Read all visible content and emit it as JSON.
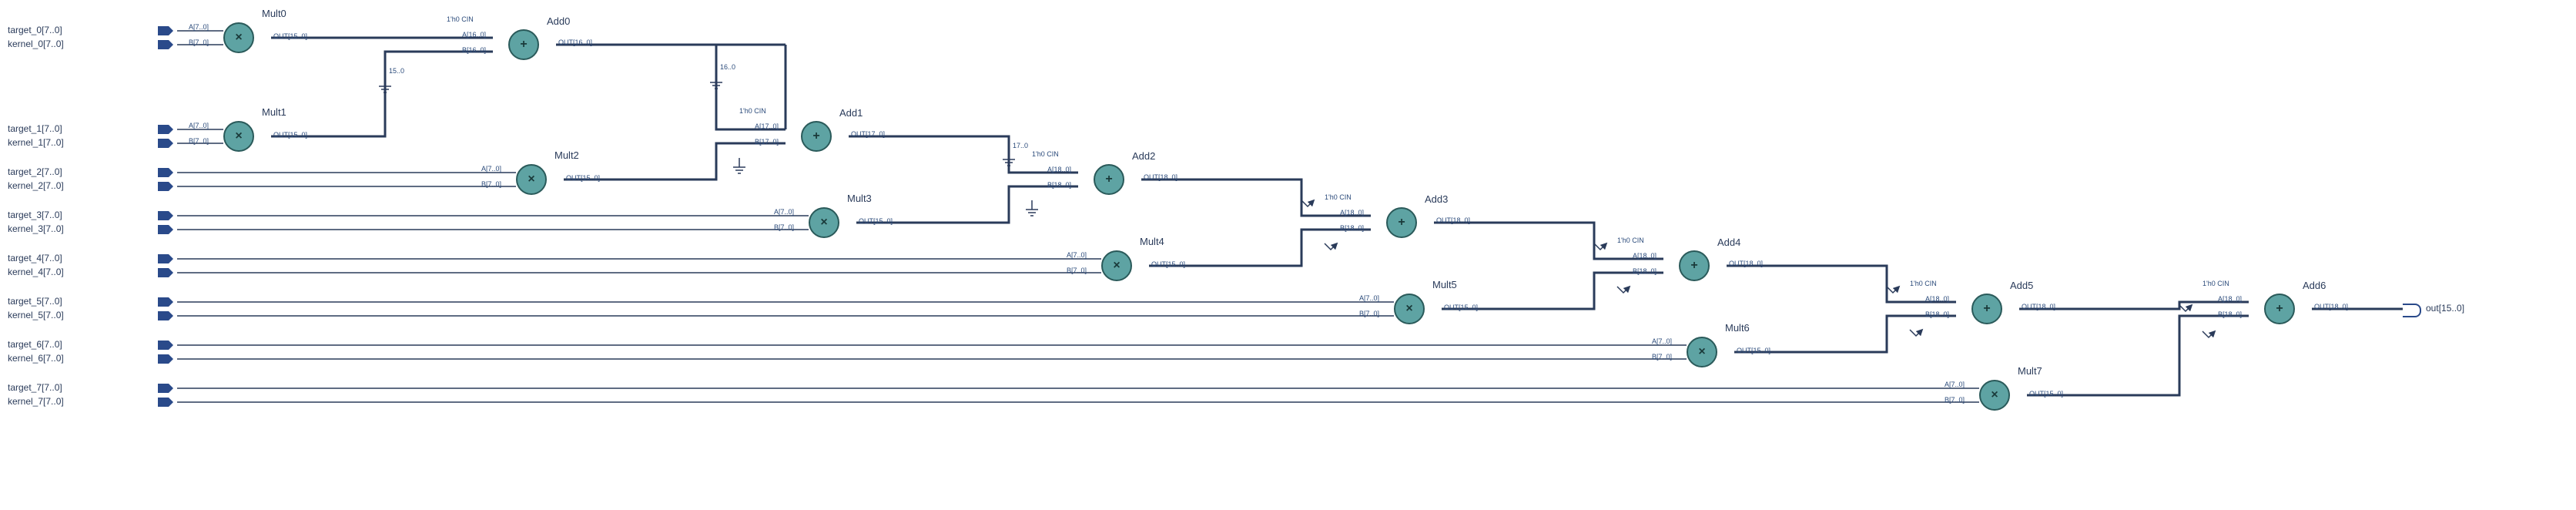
{
  "domain": "Diagram",
  "description": "RTL / netlist schematic of an 8-tap dot-product (convolution) pipeline: eight 8×8 multipliers feeding a chain of adders producing a 16-bit output.",
  "inputs": [
    {
      "name": "target_0",
      "range": "[7..0]"
    },
    {
      "name": "kernel_0",
      "range": "[7..0]"
    },
    {
      "name": "target_1",
      "range": "[7..0]"
    },
    {
      "name": "kernel_1",
      "range": "[7..0]"
    },
    {
      "name": "target_2",
      "range": "[7..0]"
    },
    {
      "name": "kernel_2",
      "range": "[7..0]"
    },
    {
      "name": "target_3",
      "range": "[7..0]"
    },
    {
      "name": "kernel_3",
      "range": "[7..0]"
    },
    {
      "name": "target_4",
      "range": "[7..0]"
    },
    {
      "name": "kernel_4",
      "range": "[7..0]"
    },
    {
      "name": "target_5",
      "range": "[7..0]"
    },
    {
      "name": "kernel_5",
      "range": "[7..0]"
    },
    {
      "name": "target_6",
      "range": "[7..0]"
    },
    {
      "name": "kernel_6",
      "range": "[7..0]"
    },
    {
      "name": "target_7",
      "range": "[7..0]"
    },
    {
      "name": "kernel_7",
      "range": "[7..0]"
    }
  ],
  "output": {
    "name": "out",
    "range": "[15..0]"
  },
  "multipliers": [
    {
      "id": "Mult0",
      "A": "A[7..0]",
      "B": "B[7..0]",
      "OUT": "OUT[15..0]"
    },
    {
      "id": "Mult1",
      "A": "A[7..0]",
      "B": "B[7..0]",
      "OUT": "OUT[15..0]"
    },
    {
      "id": "Mult2",
      "A": "A[7..0]",
      "B": "B[7..0]",
      "OUT": "OUT[15..0]"
    },
    {
      "id": "Mult3",
      "A": "A[7..0]",
      "B": "B[7..0]",
      "OUT": "OUT[15..0]"
    },
    {
      "id": "Mult4",
      "A": "A[7..0]",
      "B": "B[7..0]",
      "OUT": "OUT[15..0]"
    },
    {
      "id": "Mult5",
      "A": "A[7..0]",
      "B": "B[7..0]",
      "OUT": "OUT[15..0]"
    },
    {
      "id": "Mult6",
      "A": "A[7..0]",
      "B": "B[7..0]",
      "OUT": "OUT[15..0]"
    },
    {
      "id": "Mult7",
      "A": "A[7..0]",
      "B": "B[7..0]",
      "OUT": "OUT[15..0]"
    }
  ],
  "adders": [
    {
      "id": "Add0",
      "CIN": "1'h0 CIN",
      "A": "A[16..0]",
      "B": "B[16..0]",
      "OUT": "OUT[16..0]"
    },
    {
      "id": "Add1",
      "CIN": "1'h0 CIN",
      "A": "A[17..0]",
      "B": "B[17..0]",
      "OUT": "OUT[17..0]"
    },
    {
      "id": "Add2",
      "CIN": "1'h0 CIN",
      "A": "A[18..0]",
      "B": "B[18..0]",
      "OUT": "OUT[18..0]"
    },
    {
      "id": "Add3",
      "CIN": "1'h0 CIN",
      "A": "A[18..0]",
      "B": "B[18..0]",
      "OUT": "OUT[18..0]"
    },
    {
      "id": "Add4",
      "CIN": "1'h0 CIN",
      "A": "A[18..0]",
      "B": "B[18..0]",
      "OUT": "OUT[18..0]"
    },
    {
      "id": "Add5",
      "CIN": "1'h0 CIN",
      "A": "A[18..0]",
      "B": "B[18..0]",
      "OUT": "OUT[18..0]"
    },
    {
      "id": "Add6",
      "CIN": "1'h0 CIN",
      "A": "A[18..0]",
      "B": "B[18..0]",
      "OUT": "OUT[18..0]"
    }
  ],
  "glyphs": {
    "mult": "×",
    "add": "+"
  }
}
